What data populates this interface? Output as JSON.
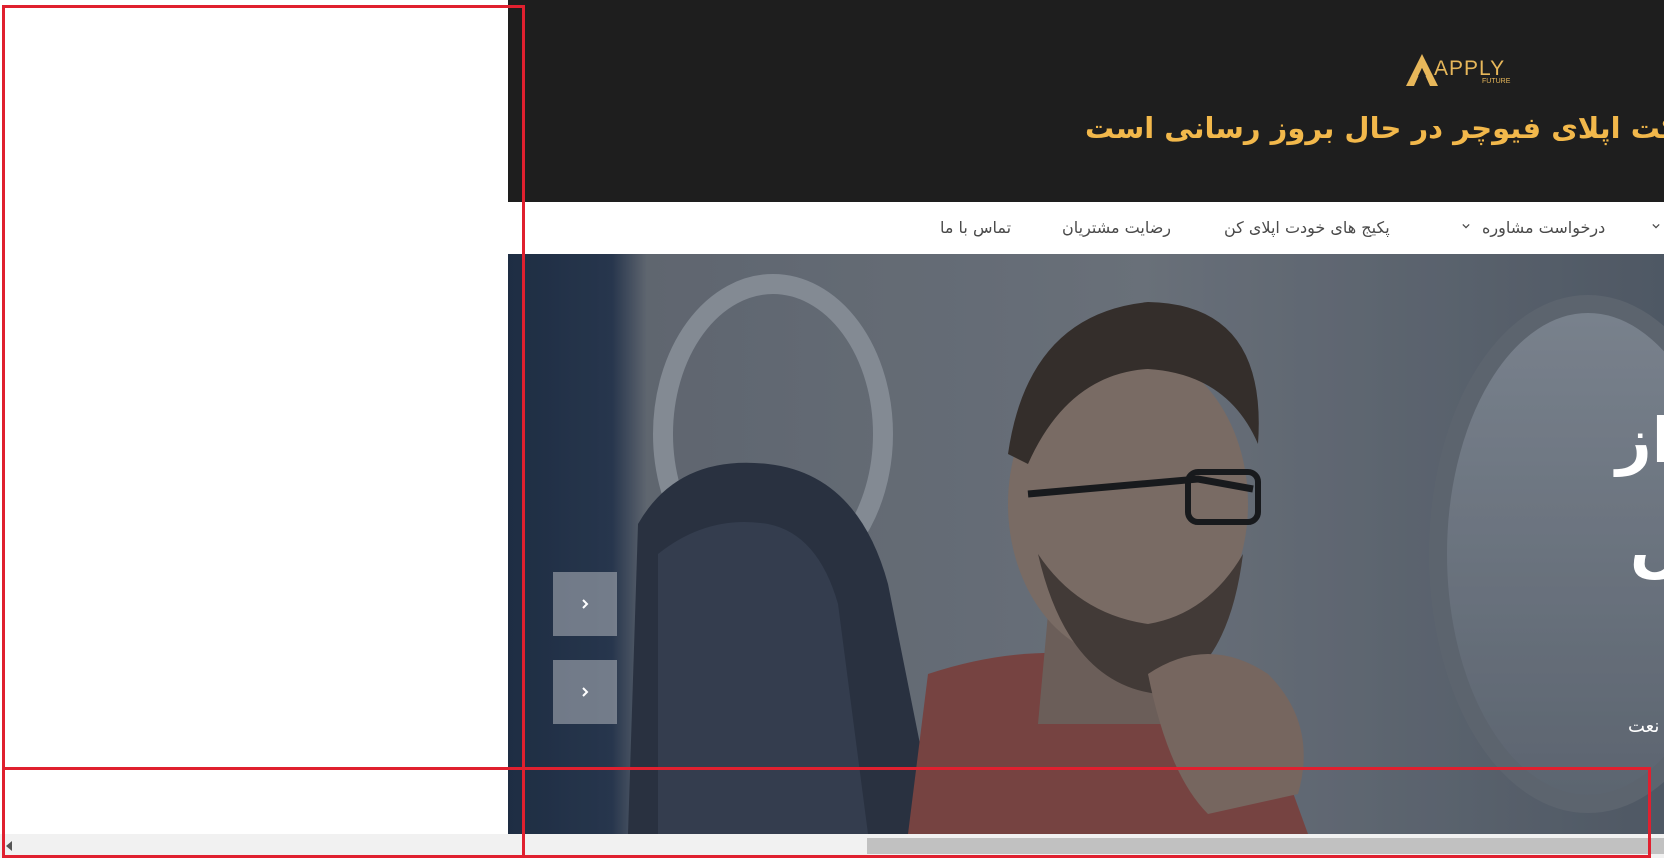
{
  "header": {
    "logo_text": "APPLY",
    "logo_subtext": "FUTURE",
    "headline": "کت اپلای فیوچر در حال بروز رسانی است",
    "headline_color": "#f2b84b",
    "background_color": "#1e1e1e"
  },
  "nav": {
    "items": [
      {
        "label": "درخواست مشاوره",
        "has_dropdown": true
      },
      {
        "label": "پکیج های خودت اپلای کن",
        "has_dropdown": false
      },
      {
        "label": "رضایت مشتریان",
        "has_dropdown": false
      },
      {
        "label": "تماس با ما",
        "has_dropdown": false
      }
    ],
    "partial_dropdown_icon": "chevron-down-icon"
  },
  "hero": {
    "heading_line1": "از",
    "heading_line2": "ں",
    "subtext": "نعت",
    "slider_buttons": [
      "chevron-left-icon",
      "chevron-right-icon"
    ]
  },
  "annotations": {
    "color": "#e0202f"
  },
  "scrollbar": {
    "left_arrow_icon": "scroll-left-arrow-icon"
  }
}
